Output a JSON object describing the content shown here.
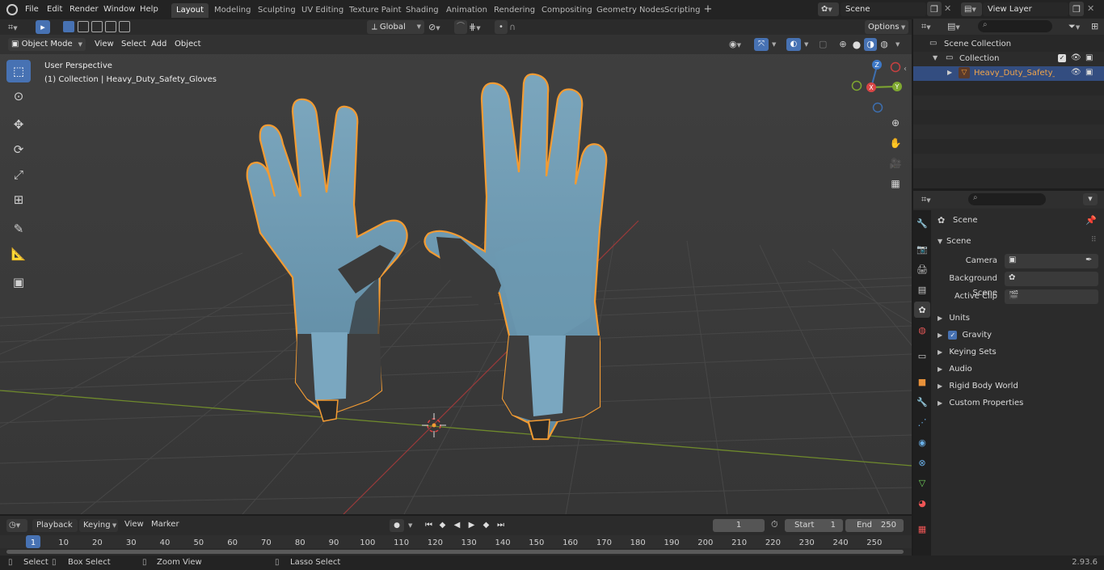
{
  "menu": [
    "File",
    "Edit",
    "Render",
    "Window",
    "Help"
  ],
  "workspaces": [
    "Layout",
    "Modeling",
    "Sculpting",
    "UV Editing",
    "Texture Paint",
    "Shading",
    "Animation",
    "Rendering",
    "Compositing",
    "Geometry Nodes",
    "Scripting"
  ],
  "active_workspace": "Layout",
  "scene_name": "Scene",
  "view_layer": "View Layer",
  "viewport": {
    "mode": "Object Mode",
    "menus": [
      "View",
      "Select",
      "Add",
      "Object"
    ],
    "transform_orientation": "Global",
    "options_label": "Options",
    "perspective_label": "User Perspective",
    "collection_label": "(1) Collection | Heavy_Duty_Safety_Gloves",
    "gizmo_axes": {
      "x": "X",
      "y": "Y",
      "z": "Z"
    }
  },
  "outliner": {
    "items": [
      {
        "label": "Scene Collection"
      },
      {
        "label": "Collection"
      },
      {
        "label": "Heavy_Duty_Safety_Glov"
      }
    ]
  },
  "properties": {
    "context": "Scene",
    "panel_title": "Scene",
    "fields": [
      {
        "label": "Camera"
      },
      {
        "label": "Background Scene"
      },
      {
        "label": "Active Clip"
      }
    ],
    "subpanels": [
      "Units",
      "Gravity",
      "Keying Sets",
      "Audio",
      "Rigid Body World",
      "Custom Properties"
    ],
    "gravity_checked": true
  },
  "timeline": {
    "menus": [
      "Playback",
      "Keying",
      "View",
      "Marker"
    ],
    "current_frame": "1",
    "start_label": "Start",
    "start_value": "1",
    "end_label": "End",
    "end_value": "250",
    "ticks": [
      "1",
      "10",
      "20",
      "30",
      "40",
      "50",
      "60",
      "70",
      "80",
      "90",
      "100",
      "110",
      "120",
      "130",
      "140",
      "150",
      "160",
      "170",
      "180",
      "190",
      "200",
      "210",
      "220",
      "230",
      "240",
      "250"
    ]
  },
  "status": {
    "select": "Select",
    "box_select": "Box Select",
    "zoom_view": "Zoom View",
    "lasso_select": "Lasso Select",
    "version": "2.93.6"
  },
  "colors": {
    "accent": "#4772b3",
    "selection_outline": "#f29b33",
    "glove_blue": "#6e9cb4",
    "x_axis": "#c0392b",
    "y_axis": "#7fa830"
  }
}
